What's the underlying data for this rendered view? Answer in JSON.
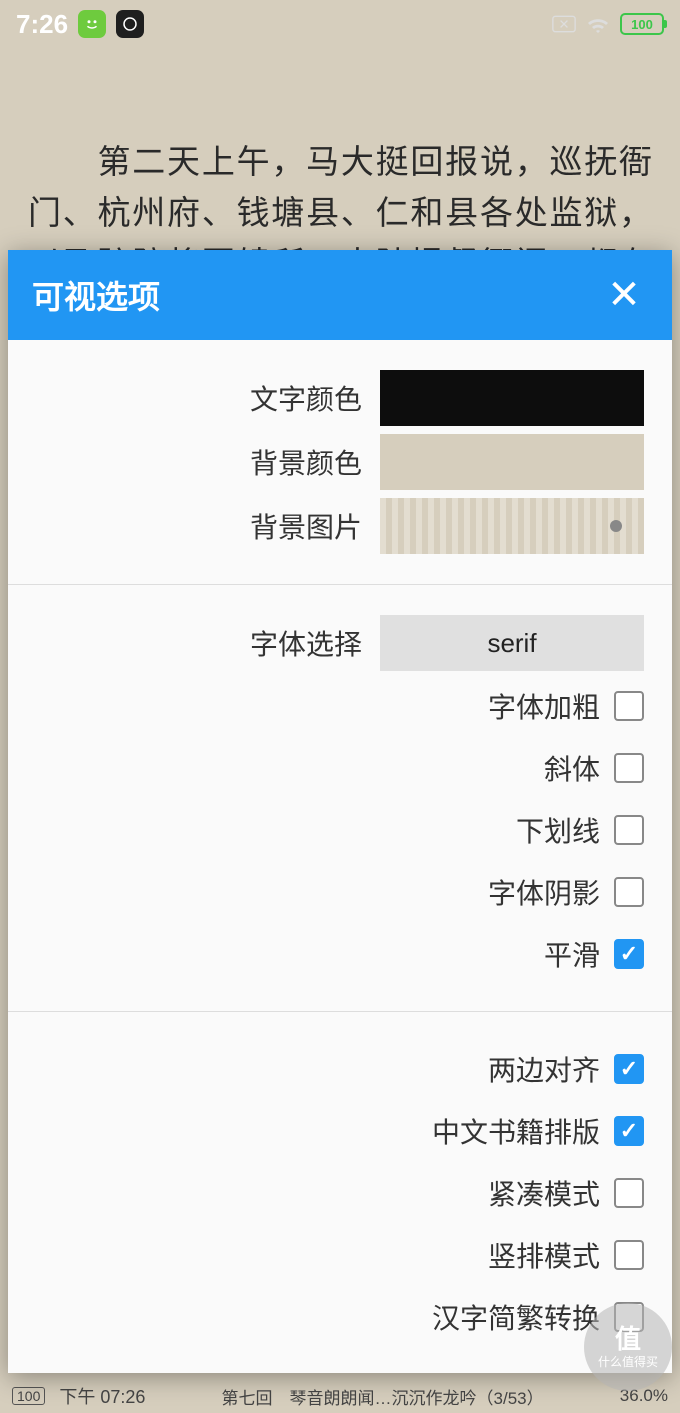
{
  "status": {
    "time": "7:26",
    "battery": "100"
  },
  "reader": {
    "text": "　　第二天上午，马大挺回报说，巡抚衙门、杭州府、钱塘县、仁和县各处监狱，以及驻防将军辕所，水陆提督衙门，都有囚单"
  },
  "bottom": {
    "battery": "100",
    "time": "下午 07:26",
    "chapter": "第七回　琴音朗朗闻…沉沉作龙吟（3/53）",
    "percent": "36.0%"
  },
  "dialog": {
    "title": "可视选项",
    "section1": {
      "text_color_label": "文字颜色",
      "bg_color_label": "背景颜色",
      "bg_image_label": "背景图片"
    },
    "section2": {
      "font_select_label": "字体选择",
      "font_value": "serif",
      "checks": {
        "bold": "字体加粗",
        "italic": "斜体",
        "underline": "下划线",
        "shadow": "字体阴影",
        "smooth": "平滑"
      }
    },
    "section3": {
      "checks": {
        "justify": "两边对齐",
        "cjk_layout": "中文书籍排版",
        "compact": "紧凑模式",
        "vertical": "竖排模式",
        "trad_simp": "汉字简繁转换"
      }
    }
  },
  "watermark": {
    "line1": "值",
    "line2": "什么值得买"
  },
  "colors": {
    "accent": "#2196F3",
    "reader_bg": "#d6cebd",
    "text_swatch": "#0d0d0d"
  }
}
